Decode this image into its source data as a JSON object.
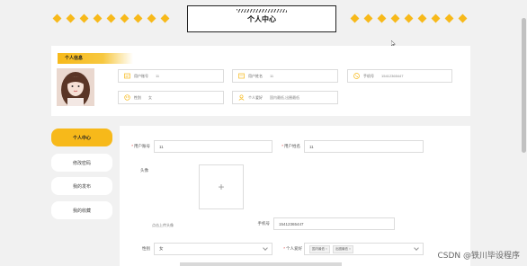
{
  "header": {
    "title": "个人中心"
  },
  "info": {
    "section_title": "个人信息",
    "fields": [
      {
        "label": "用户账号",
        "value": "11"
      },
      {
        "label": "用户姓名",
        "value": "11"
      },
      {
        "label": "手机号",
        "value": "15412365447"
      },
      {
        "label": "性别",
        "value": "女"
      },
      {
        "label": "个人爱好",
        "value": "国内最低,出圈最低"
      }
    ]
  },
  "sidebar": {
    "items": [
      {
        "label": "个人中心",
        "active": true
      },
      {
        "label": "修改密码",
        "active": false
      },
      {
        "label": "我的发布",
        "active": false
      },
      {
        "label": "我的收藏",
        "active": false
      }
    ]
  },
  "form": {
    "account_label": "用户账号",
    "account_value": "11",
    "name_label": "用户姓名",
    "name_value": "11",
    "avatar_label": "头像",
    "upload_hint": "点击上传头像",
    "phone_label": "手机号",
    "phone_value": "15412365447",
    "gender_label": "性别",
    "gender_value": "女",
    "hobby_label": "个人爱好",
    "hobby_tags": [
      "国内最低",
      "出圈最低"
    ]
  },
  "watermark": "CSDN @铁川毕设程序",
  "colors": {
    "accent": "#f7b91a",
    "required": "#e04040"
  }
}
